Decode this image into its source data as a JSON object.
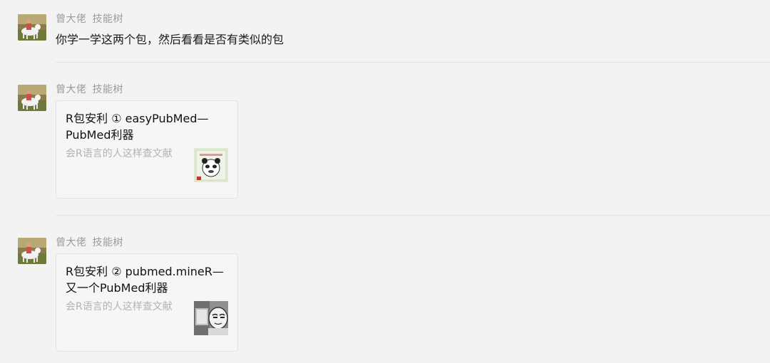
{
  "messages": [
    {
      "sender": "曾大佬",
      "group": "技能树",
      "text": "你学一学这两个包，然后看看是否有类似的包"
    },
    {
      "sender": "曾大佬",
      "group": "技能树",
      "card": {
        "title": "R包安利 ① easyPubMed—PubMed利器",
        "description": "会R语言的人这样查文献",
        "thumbnail": "panda-meme-thumbnail"
      }
    },
    {
      "sender": "曾大佬",
      "group": "技能树",
      "card": {
        "title": "R包安利 ② pubmed.mineR—又一个PubMed利器",
        "description": "会R语言的人这样查文献",
        "thumbnail": "cartoon-reader-thumbnail"
      }
    }
  ],
  "colors": {
    "background": "#f3f3f3",
    "card_background": "#f6f6f6",
    "meta_text": "#9b9b9b",
    "desc_text": "#b3b3b3"
  }
}
